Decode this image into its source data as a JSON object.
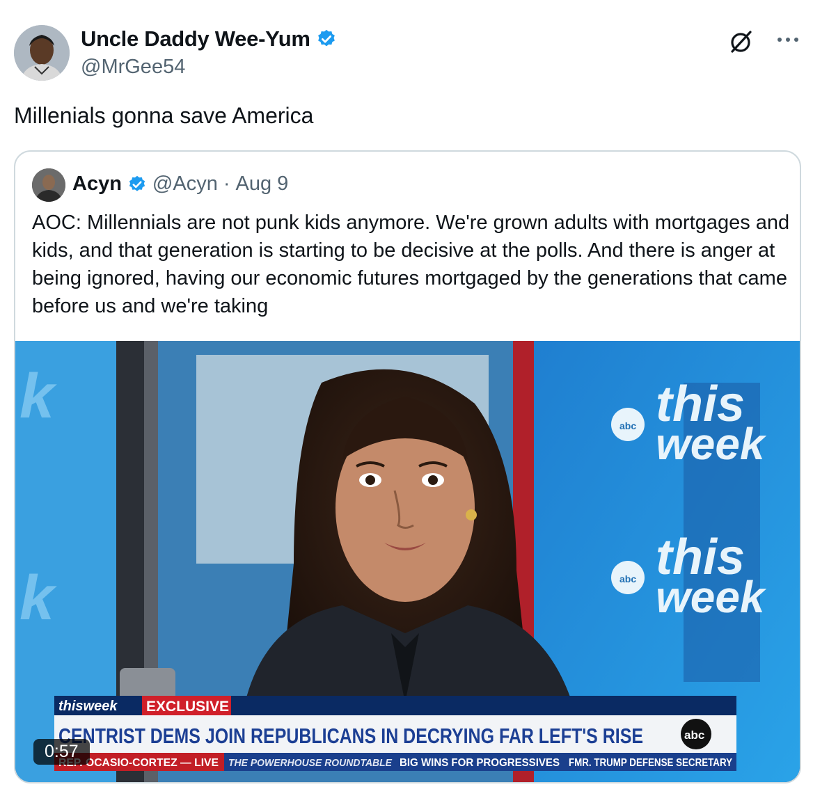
{
  "author": {
    "display_name": "Uncle Daddy Wee-Yum",
    "handle": "@MrGee54",
    "avatar_icon": "avatar-child-photo"
  },
  "tweet": {
    "text": "Millenials gonna save America"
  },
  "quoted_tweet": {
    "display_name": "Acyn",
    "handle": "@Acyn",
    "separator": "·",
    "date": "Aug 9",
    "text": "AOC: Millennials are not punk kids anymore. We're grown adults with mortgages and kids, and that generation is starting to be decisive at the polls. And there is anger at being ignored, having our economic futures mortgaged by the generations that came before us and we're taking"
  },
  "video": {
    "duration": "0:57",
    "bug_top": "this",
    "bug_bottom": "week",
    "banner_show": "thisweek",
    "banner_tag": "EXCLUSIVE",
    "headline": "CENTRIST DEMS JOIN REPUBLICANS IN DECRYING FAR LEFT'S RISE",
    "network_logo": "abc",
    "ticker": [
      "REP. OCASIO-CORTEZ — LIVE",
      "THE POWERHOUSE ROUNDTABLE",
      "BIG WINS FOR PROGRESSIVES",
      "FMR. TRUMP DEFENSE SECRETARY"
    ]
  },
  "colors": {
    "verified": "#1d9bf0",
    "text_primary": "#0f1419",
    "text_secondary": "#536471",
    "border": "#cfd9de",
    "banner_red": "#d0202a",
    "headline_blue": "#1c3f94"
  },
  "icons": {
    "grok": "grok-icon",
    "more": "more-icon",
    "verified": "verified-badge-icon"
  }
}
